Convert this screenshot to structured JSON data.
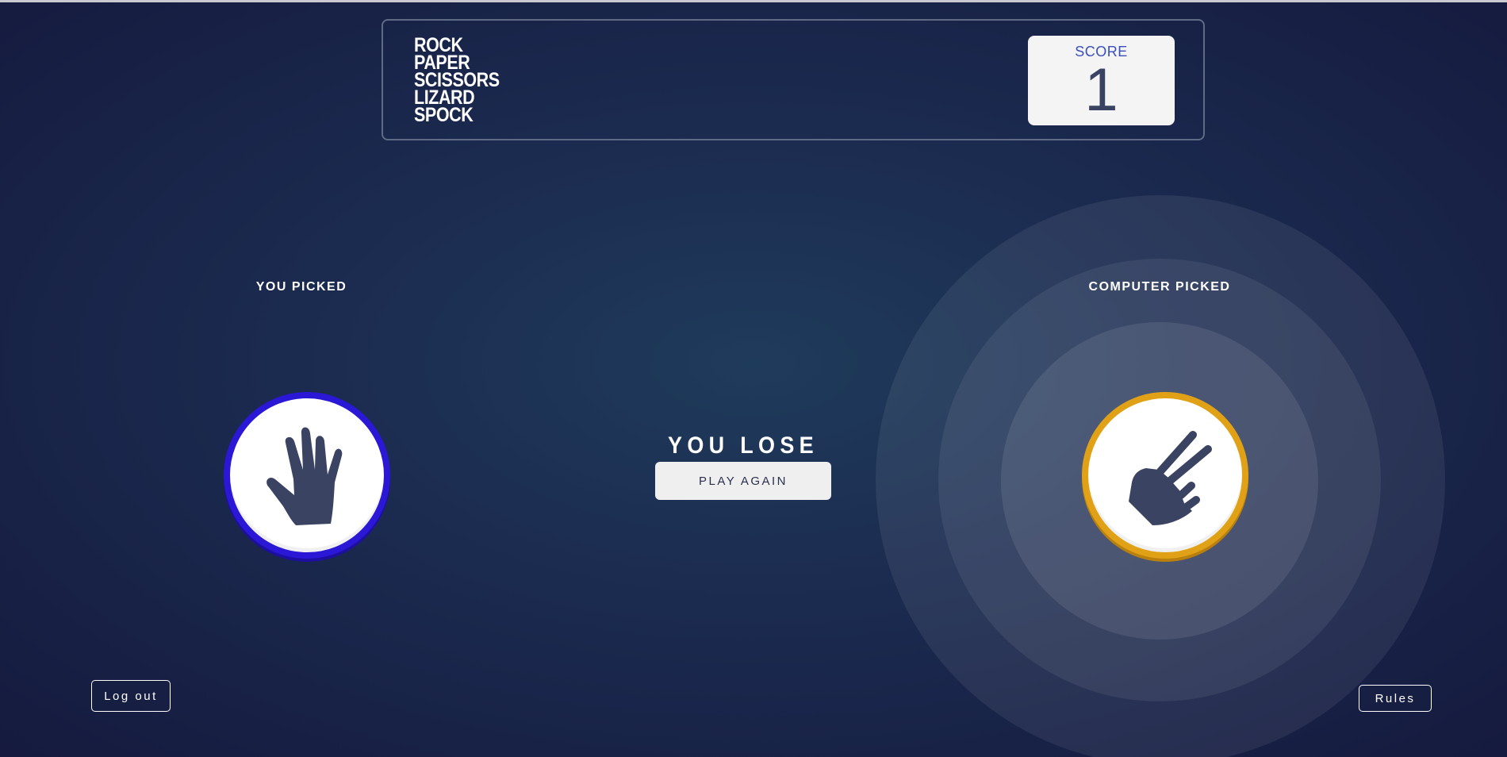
{
  "header": {
    "logo_lines": [
      "ROCK",
      "PAPER",
      "SCISSORS",
      "LIZARD",
      "SPOCK"
    ],
    "score_label": "SCORE",
    "score_value": "1"
  },
  "player": {
    "label": "YOU PICKED",
    "choice": "paper",
    "icon": "paper-hand-icon",
    "ring_color": "#2a18d6"
  },
  "computer": {
    "label": "COMPUTER PICKED",
    "choice": "scissors",
    "icon": "scissors-hand-icon",
    "ring_color": "#e0a116"
  },
  "result": {
    "text": "YOU LOSE",
    "play_again_label": "PLAY AGAIN"
  },
  "footer": {
    "logout_label": "Log out",
    "rules_label": "Rules"
  },
  "colors": {
    "background": "#1b2a4f",
    "icon_fill": "#3b4363",
    "score_label": "#3b4fb8"
  }
}
